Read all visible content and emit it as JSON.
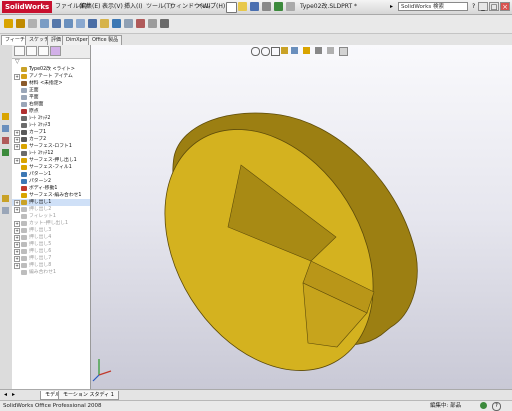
{
  "app": {
    "logo": "SolidWorks",
    "document_title": "Type02改.SLDPRT *",
    "search_placeholder": "SolidWorks 検索",
    "window_buttons": [
      "_",
      "□",
      "×"
    ]
  },
  "menu": [
    "ファイル(F)",
    "編集(E)",
    "表示(V)",
    "挿入(I)",
    "ツール(T)",
    "ウィンドウ(W)",
    "ヘルプ(H)"
  ],
  "command_tabs": [
    "フィーチャー",
    "スケッチ",
    "評価",
    "DimXpert",
    "Office 製品"
  ],
  "feature_tree": {
    "items": [
      {
        "label": "Type02改 <ライト>",
        "icon": "part-icon",
        "expand": false,
        "color": "#c9a227",
        "sup": false
      },
      {
        "label": "アノテート アイテム",
        "icon": "annotation-icon",
        "expand": true,
        "color": "#d4a017",
        "sup": false
      },
      {
        "label": "材料 <未指定>",
        "icon": "material-icon",
        "expand": false,
        "color": "#8b5a2b",
        "sup": false
      },
      {
        "label": "正面",
        "icon": "plane-icon",
        "expand": false,
        "color": "#9aa6b8",
        "sup": false
      },
      {
        "label": "平面",
        "icon": "plane-icon",
        "expand": false,
        "color": "#9aa6b8",
        "sup": false
      },
      {
        "label": "右側面",
        "icon": "plane-icon",
        "expand": false,
        "color": "#9aa6b8",
        "sup": false
      },
      {
        "label": "原点",
        "icon": "origin-icon",
        "expand": false,
        "color": "#b03030",
        "sup": false
      },
      {
        "label": "ｼｰﾄ ｽｹｯﾁ2",
        "icon": "sketch-icon",
        "expand": false,
        "color": "#6b6b6b",
        "sup": false
      },
      {
        "label": "ｼｰﾄ ｽｹｯﾁ3",
        "icon": "sketch-icon",
        "expand": false,
        "color": "#6b6b6b",
        "sup": false
      },
      {
        "label": "カーブ1",
        "icon": "curve-icon",
        "expand": true,
        "color": "#5a5a5a",
        "sup": false
      },
      {
        "label": "カーブ2",
        "icon": "curve-icon",
        "expand": true,
        "color": "#5a5a5a",
        "sup": false
      },
      {
        "label": "サーフェス-ロフト1",
        "icon": "surface-icon",
        "expand": true,
        "color": "#d9a400",
        "sup": false
      },
      {
        "label": "ｼｰﾄ ｽｹｯﾁ12",
        "icon": "sketch-icon",
        "expand": false,
        "color": "#6b6b6b",
        "sup": false
      },
      {
        "label": "サーフェス-押し出し1",
        "icon": "surface-icon",
        "expand": true,
        "color": "#d9a400",
        "sup": false
      },
      {
        "label": "サーフェス-フィル1",
        "icon": "surface-icon",
        "expand": false,
        "color": "#d9a400",
        "sup": false
      },
      {
        "label": "パターン1",
        "icon": "pattern-icon",
        "expand": false,
        "color": "#3c78b4",
        "sup": false
      },
      {
        "label": "パターン2",
        "icon": "pattern-icon",
        "expand": false,
        "color": "#3c78b4",
        "sup": false
      },
      {
        "label": "ボディ-移動1",
        "icon": "move-body-icon",
        "expand": false,
        "color": "#c0392b",
        "sup": false
      },
      {
        "label": "サーフェス-編み合わせ1",
        "icon": "knit-icon",
        "expand": false,
        "color": "#d9a400",
        "sup": false
      },
      {
        "label": "押し出し1",
        "icon": "extrude-icon",
        "expand": true,
        "color": "#c9a227",
        "sup": false,
        "selected": true
      },
      {
        "label": "押し出し2",
        "icon": "extrude-icon",
        "expand": true,
        "color": "#bdbdbd",
        "sup": true
      },
      {
        "label": "フィレット1",
        "icon": "fillet-icon",
        "expand": false,
        "color": "#bdbdbd",
        "sup": true
      },
      {
        "label": "カットｰ押し出し1",
        "icon": "cut-icon",
        "expand": true,
        "color": "#bdbdbd",
        "sup": true
      },
      {
        "label": "押し出し3",
        "icon": "extrude-icon",
        "expand": true,
        "color": "#bdbdbd",
        "sup": true
      },
      {
        "label": "押し出し4",
        "icon": "extrude-icon",
        "expand": true,
        "color": "#bdbdbd",
        "sup": true
      },
      {
        "label": "押し出し5",
        "icon": "extrude-icon",
        "expand": true,
        "color": "#bdbdbd",
        "sup": true
      },
      {
        "label": "押し出し6",
        "icon": "extrude-icon",
        "expand": true,
        "color": "#bdbdbd",
        "sup": true
      },
      {
        "label": "押し出し7",
        "icon": "extrude-icon",
        "expand": true,
        "color": "#bdbdbd",
        "sup": true
      },
      {
        "label": "押し出し8",
        "icon": "extrude-icon",
        "expand": true,
        "color": "#bdbdbd",
        "sup": true
      },
      {
        "label": "編み合わせ1",
        "icon": "knit-icon",
        "expand": false,
        "color": "#bdbdbd",
        "sup": true
      }
    ]
  },
  "bottom_tabs": [
    "モデル",
    "モーション スタディ 1"
  ],
  "status": {
    "left": "SolidWorks Office Professional 2008",
    "right": "編集中: 部品"
  },
  "colors": {
    "part_face": "#d4b21f",
    "part_dark": "#8a7010",
    "part_edge": "#5e4c0a",
    "viewport_bg": "#e6e6ee"
  }
}
